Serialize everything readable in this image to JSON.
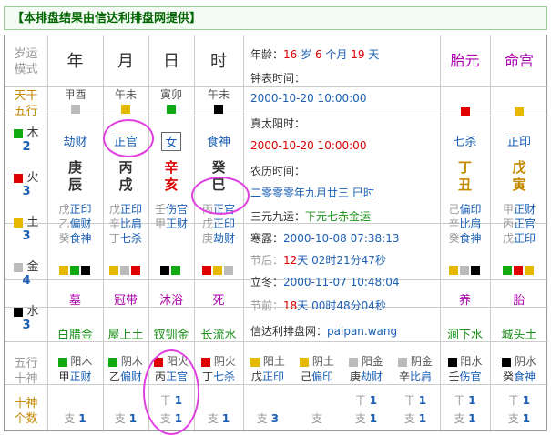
{
  "banner": "【本排盘结果由信达利排盘网提供】",
  "left_labels": {
    "suiyun": [
      "岁运",
      "模式"
    ],
    "tiangan_wuxing": [
      "天干",
      "五行"
    ],
    "wuxing_counts": [
      {
        "name": "木",
        "count": "2",
        "color": "#11aa11"
      },
      {
        "name": "火",
        "count": "3",
        "color": "#e00000"
      },
      {
        "name": "土",
        "count": "3",
        "color": "#e6b800"
      },
      {
        "name": "金",
        "count": "4",
        "color": "#bbbbbb"
      },
      {
        "name": "水",
        "count": "3",
        "color": "#000000"
      }
    ],
    "wuxing_shishen": [
      "五行",
      "十神"
    ],
    "shishen_geshu": [
      "十神",
      "个数"
    ]
  },
  "pillars": [
    {
      "title": "年",
      "nayin_pair": "甲酉",
      "sq": "#bbbbbb",
      "ten_god": "劫财",
      "gan": "庚",
      "zhi": "辰",
      "hidden": [
        {
          "c": "戊",
          "g": "正印"
        },
        {
          "c": "乙",
          "g": "偏财"
        },
        {
          "c": "癸",
          "g": "食神"
        }
      ],
      "dots": [
        "#e6b800",
        "#11aa11",
        "#000000"
      ],
      "stage": "墓",
      "nayin": "白腊金",
      "elem": {
        "sq": "#11aa11",
        "label": "阳木",
        "c": "甲",
        "g": "正财"
      },
      "gan_count": "",
      "zhi_count": "1"
    },
    {
      "title": "月",
      "nayin_pair": "午未",
      "sq": "#e6b800",
      "ten_god": "正官",
      "gan": "丙",
      "zhi": "戌",
      "hidden": [
        {
          "c": "戊",
          "g": "正印"
        },
        {
          "c": "辛",
          "g": "比肩"
        },
        {
          "c": "丁",
          "g": "七杀"
        }
      ],
      "dots": [
        "#e6b800",
        "#bbbbbb",
        "#e00000"
      ],
      "stage": "冠带",
      "nayin": "屋上土",
      "elem": {
        "sq": "#11aa11",
        "label": "阴木",
        "c": "乙",
        "g": "偏财"
      },
      "gan_count": "",
      "zhi_count": "1"
    },
    {
      "title": "日",
      "nayin_pair": "寅卯",
      "sq": "#11aa11",
      "ten_god": "女",
      "gan": "辛",
      "zhi": "亥",
      "hidden": [
        {
          "c": "壬",
          "g": "伤官"
        },
        {
          "c": "甲",
          "g": "正财"
        }
      ],
      "dots": [
        "#000000",
        "#11aa11"
      ],
      "stage": "沐浴",
      "nayin": "钗钏金",
      "elem": {
        "sq": "#e00000",
        "label": "阳火",
        "c": "丙",
        "g": "正官"
      },
      "gan_count": "1",
      "zhi_count": "1"
    },
    {
      "title": "时",
      "nayin_pair": "午未",
      "sq": "#000000",
      "ten_god": "食神",
      "gan": "癸",
      "zhi": "巳",
      "hidden": [
        {
          "c": "丙",
          "g": "正官"
        },
        {
          "c": "戊",
          "g": "正印"
        },
        {
          "c": "庚",
          "g": "劫财"
        }
      ],
      "dots": [
        "#e00000",
        "#e6b800",
        "#bbbbbb"
      ],
      "stage": "死",
      "nayin": "长流水",
      "elem": {
        "sq": "#e00000",
        "label": "阴火",
        "c": "丁",
        "g": "七杀"
      },
      "gan_count": "",
      "zhi_count": "1"
    }
  ],
  "middle": {
    "age_label": "年龄：",
    "age_year": "16",
    "age_y_unit": "岁",
    "age_month": "6",
    "age_m_unit": "个月",
    "age_day": "19",
    "age_d_unit": "天",
    "clock_label": "钟表时间：",
    "clock_value": "2000-10-20 10:00:00",
    "solar_label": "真太阳时：",
    "solar_value": "2000-10-20 10:00:00",
    "lunar_label": "农历时间：",
    "lunar_value": "二零零零年九月廿三 巳时",
    "sanyuan_label": "三元九运：",
    "sanyuan_value": "下元七赤金运",
    "hanlu_label": "寒露：",
    "hanlu_value": "2000-10-08 07:38:13",
    "jiehou": "节后：",
    "jiehou_days": "12",
    "jiehou_rest": "天 02时21分47秒",
    "lidong_label": "立冬：",
    "lidong_value": "2000-11-07 10:48:04",
    "jieqian": "节前：",
    "jieqian_days": "18",
    "jieqian_rest": "天 00时48分04秒",
    "site_label": "信达利排盘网：",
    "site_value": "paipan.wang",
    "elem": {
      "sq": "#e6b800",
      "label": "阳土",
      "c": "戊",
      "g": "正印"
    },
    "zhi_count": "3"
  },
  "right_cols": [
    {
      "title": "胎元",
      "sq": "#e00000",
      "ten_god": "七杀",
      "gan": "丁",
      "zhi": "丑",
      "hidden": [
        {
          "c": "己",
          "g": "偏印"
        },
        {
          "c": "辛",
          "g": "比肩"
        },
        {
          "c": "癸",
          "g": "食神"
        }
      ],
      "dots": [
        "#e6b800",
        "#bbbbbb",
        "#000000"
      ],
      "stage": "养",
      "nayin": "涧下水",
      "elem": {
        "sq": "#000000",
        "label": "阳水",
        "c": "壬",
        "g": "伤官"
      },
      "gan_count": "1",
      "zhi_count": "1"
    },
    {
      "title": "命宫",
      "sq": "#e6b800",
      "ten_god": "正印",
      "gan": "戊",
      "zhi": "寅",
      "hidden": [
        {
          "c": "甲",
          "g": "正财"
        },
        {
          "c": "丙",
          "g": "正官"
        },
        {
          "c": "戊",
          "g": "正印"
        }
      ],
      "dots": [
        "#11aa11",
        "#e00000",
        "#e6b800"
      ],
      "stage": "胎",
      "nayin": "城头土",
      "elem": {
        "sq": "#000000",
        "label": "阴水",
        "c": "癸",
        "g": "食神"
      },
      "gan_count": "1",
      "zhi_count": "1"
    }
  ],
  "extra_elems": [
    {
      "sq": "#e6b800",
      "label": "阴土",
      "c": "己",
      "g": "偏印"
    },
    {
      "sq": "#bbbbbb",
      "label": "阳金",
      "c": "庚",
      "g": "劫财"
    },
    {
      "sq": "#bbbbbb",
      "label": "阴金",
      "c": "辛",
      "g": "比肩"
    }
  ],
  "labels": {
    "gan": "干",
    "zhi": "支"
  }
}
